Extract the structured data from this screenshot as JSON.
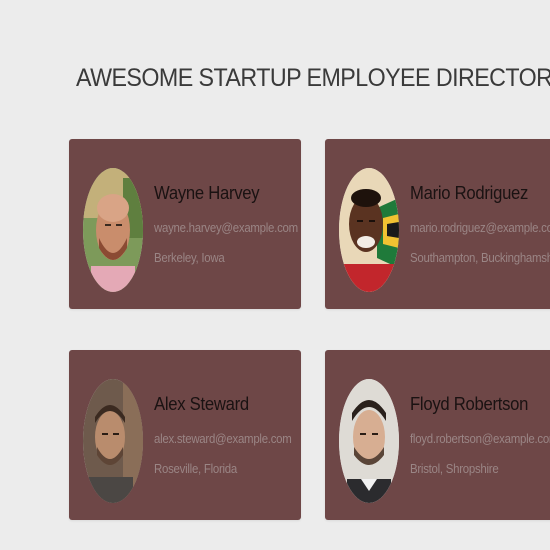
{
  "header": {
    "title": "AWESOME STARTUP EMPLOYEE DIRECTORY"
  },
  "employees": [
    {
      "name": "Wayne Harvey",
      "email": "wayne.harvey@example.com",
      "location": "Berkeley, Iowa",
      "avatar_icon": "person-photo-icon"
    },
    {
      "name": "Mario Rodriguez",
      "email": "mario.rodriguez@example.com",
      "location": "Southampton, Buckinghamshire",
      "avatar_icon": "person-photo-icon"
    },
    {
      "name": "Alex Steward",
      "email": "alex.steward@example.com",
      "location": "Roseville, Florida",
      "avatar_icon": "person-photo-icon"
    },
    {
      "name": "Floyd Robertson",
      "email": "floyd.robertson@example.com",
      "location": "Bristol, Shropshire",
      "avatar_icon": "person-photo-icon"
    }
  ],
  "colors": {
    "background": "#ececec",
    "card": "#6e4747",
    "name_text": "#1a1212",
    "detail_text": "#9a8585",
    "title_text": "#3a3a3a"
  }
}
